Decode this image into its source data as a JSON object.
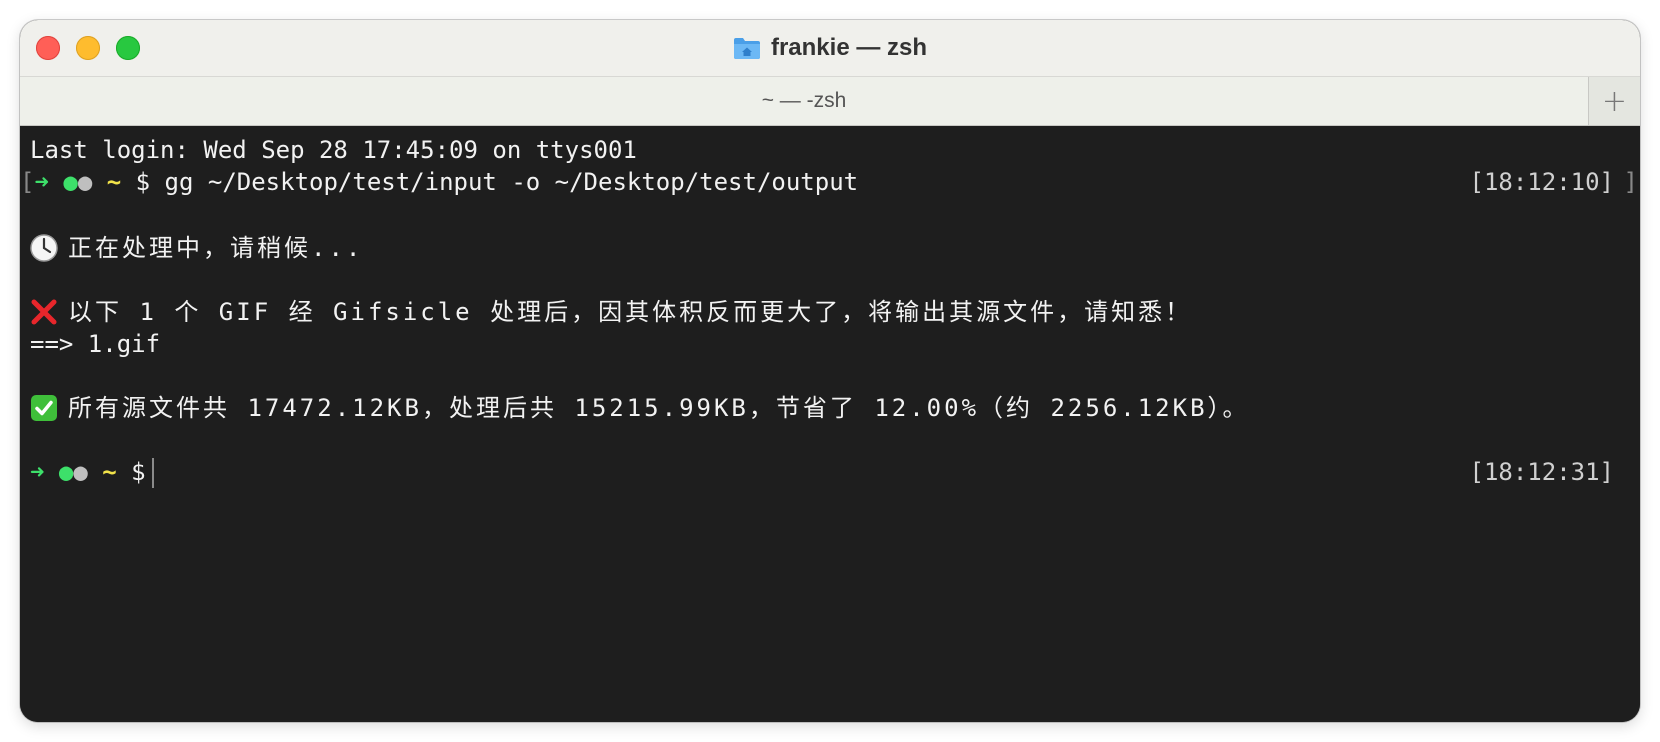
{
  "window": {
    "title": "frankie — zsh"
  },
  "tab": {
    "label": "~ — -zsh",
    "new_tab_symbol": "+"
  },
  "colors": {
    "close": "#ff5f57",
    "minimize": "#febc2e",
    "zoom": "#28c840",
    "terminal_bg": "#1e1e1e",
    "prompt_arrow": "#3de06a",
    "prompt_tilde": "#f2e34a"
  },
  "terminal": {
    "last_login": "Last login: Wed Sep 28 17:45:09 on ttys001",
    "prompt1": {
      "bracket_open": "[",
      "arrow": "➜",
      "dot1": "●",
      "dot2": "●",
      "tilde": "~",
      "dollar": "$",
      "command": "gg ~/Desktop/test/input -o ~/Desktop/test/output",
      "timestamp": "[18:12:10]",
      "bracket_close": "]"
    },
    "processing": "正在处理中，请稍候...",
    "warning": "以下 1 个 GIF 经 Gifsicle 处理后，因其体积反而更大了，将输出其源文件，请知悉！",
    "warning_file": "==> 1.gif",
    "summary": "所有源文件共 17472.12KB，处理后共 15215.99KB，节省了 12.00%（约 2256.12KB）。",
    "prompt2": {
      "arrow": "➜",
      "dot1": "●",
      "dot2": "●",
      "tilde": "~",
      "dollar": "$",
      "timestamp": "[18:12:31]"
    }
  }
}
